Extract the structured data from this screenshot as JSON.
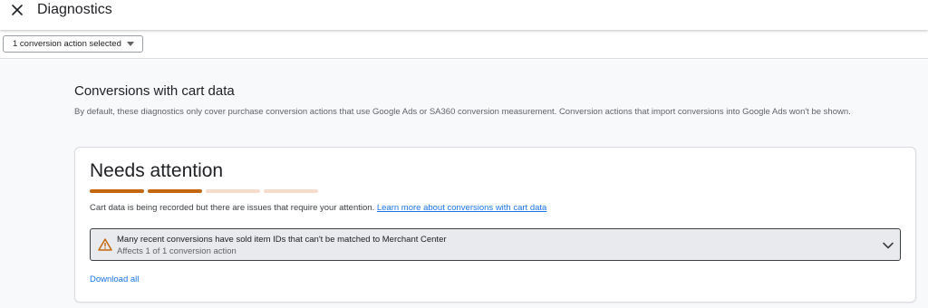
{
  "header": {
    "title": "Diagnostics",
    "close_icon": "close-icon"
  },
  "filter": {
    "selected_label": "1 conversion action selected",
    "dropdown_icon": "caret-down-icon"
  },
  "section": {
    "title": "Conversions with cart data",
    "description": "By default, these diagnostics only cover purchase conversion actions that use Google Ads or SA360 conversion measurement. Conversion actions that import conversions into Google Ads won't be shown."
  },
  "status_card": {
    "title": "Needs attention",
    "progress": {
      "filled_segments": 2,
      "total_segments": 4
    },
    "colors": {
      "filled": "#c5670f",
      "empty": "#f8dccb",
      "link": "#1a73e8"
    },
    "message": "Cart data is being recorded but there are issues that require your attention.",
    "learn_more_label": "Learn more about conversions with cart data",
    "issue": {
      "icon": "warning-icon",
      "title": "Many recent conversions have sold item IDs that can't be matched to Merchant Center",
      "subtitle": "Affects 1 of 1 conversion action",
      "expand_icon": "chevron-down-icon"
    },
    "download_label": "Download all"
  }
}
